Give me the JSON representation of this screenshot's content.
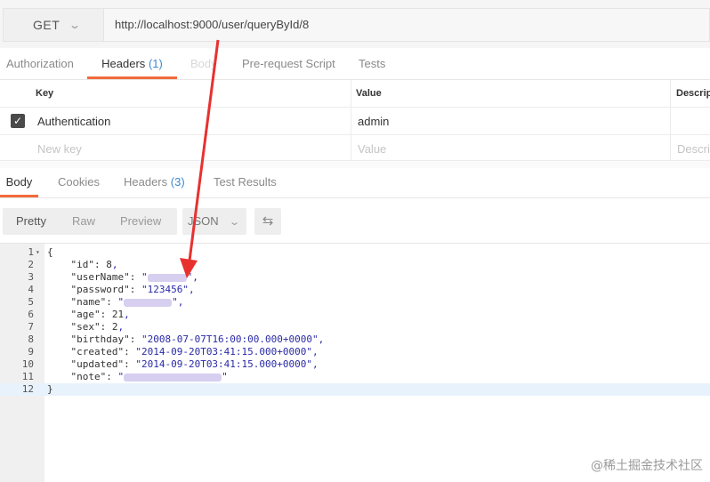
{
  "request": {
    "method": "GET",
    "url": "http://localhost:9000/user/queryById/8"
  },
  "request_tabs": [
    {
      "label": "Authorization",
      "count": ""
    },
    {
      "label": "Headers",
      "count": "(1)"
    },
    {
      "label": "Body",
      "count": ""
    },
    {
      "label": "Pre-request Script",
      "count": ""
    },
    {
      "label": "Tests",
      "count": ""
    }
  ],
  "headers_table": {
    "columns": [
      "Key",
      "Value",
      "Description"
    ],
    "rows": [
      {
        "checked": true,
        "key": "Authentication",
        "value": "admin",
        "description": ""
      }
    ],
    "placeholders": {
      "key": "New key",
      "value": "Value",
      "description": "Description"
    }
  },
  "response_tabs": [
    {
      "label": "Body",
      "count": ""
    },
    {
      "label": "Cookies",
      "count": ""
    },
    {
      "label": "Headers",
      "count": "(3)"
    },
    {
      "label": "Test Results",
      "count": ""
    }
  ],
  "view_modes": [
    "Pretty",
    "Raw",
    "Preview"
  ],
  "format_selected": "JSON",
  "code_lines": [
    {
      "n": "1",
      "text": "{"
    },
    {
      "n": "2",
      "key": "\"id\"",
      "val": "8",
      "type": "num",
      "comma": ","
    },
    {
      "n": "3",
      "key": "\"userName\"",
      "val": "\"",
      "type": "str-blur",
      "comma": "\","
    },
    {
      "n": "4",
      "key": "\"password\"",
      "val": "\"123456\"",
      "type": "str",
      "comma": ","
    },
    {
      "n": "5",
      "key": "\"name\"",
      "val": "\"",
      "type": "str-blur",
      "comma": "\","
    },
    {
      "n": "6",
      "key": "\"age\"",
      "val": "21",
      "type": "num",
      "comma": ","
    },
    {
      "n": "7",
      "key": "\"sex\"",
      "val": "2",
      "type": "num",
      "comma": ","
    },
    {
      "n": "8",
      "key": "\"birthday\"",
      "val": "\"2008-07-07T16:00:00.000+0000\"",
      "type": "str",
      "comma": ","
    },
    {
      "n": "9",
      "key": "\"created\"",
      "val": "\"2014-09-20T03:41:15.000+0000\"",
      "type": "str",
      "comma": ","
    },
    {
      "n": "10",
      "key": "\"updated\"",
      "val": "\"2014-09-20T03:41:15.000+0000\"",
      "type": "str",
      "comma": ","
    },
    {
      "n": "11",
      "key": "\"note\"",
      "val": "\"",
      "type": "str-blur",
      "comma": "\""
    },
    {
      "n": "12",
      "text": "}"
    }
  ],
  "watermark": "@稀土掘金技术社区",
  "colors": {
    "accent": "#f26b3a",
    "count_blue": "#3d8ad1",
    "arrow_red": "#e8312f",
    "string_blue": "#2a2aa8"
  }
}
